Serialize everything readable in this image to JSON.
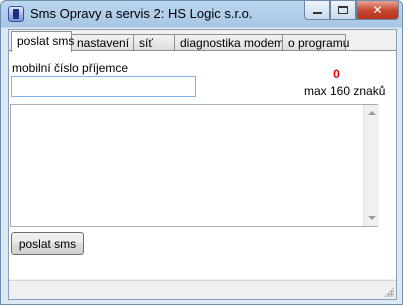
{
  "window": {
    "title": "Sms Opravy a servis 2: HS Logic s.r.o.",
    "close_glyph": "✕"
  },
  "tabs": [
    {
      "label": "poslat sms",
      "active": true
    },
    {
      "label": "nastavení",
      "active": false
    },
    {
      "label": "síť",
      "active": false
    },
    {
      "label": "diagnostika modemu",
      "active": false
    },
    {
      "label": "o programu",
      "active": false
    }
  ],
  "form": {
    "mobile_label": "mobilní číslo příjemce",
    "mobile_value": "",
    "char_count": "0",
    "max_label": "max 160 znaků",
    "message_value": "",
    "send_label": "poslat sms"
  },
  "status": {
    "text": ""
  },
  "colors": {
    "counter": "#e00000",
    "input_focus_border": "#7eb4ea"
  }
}
